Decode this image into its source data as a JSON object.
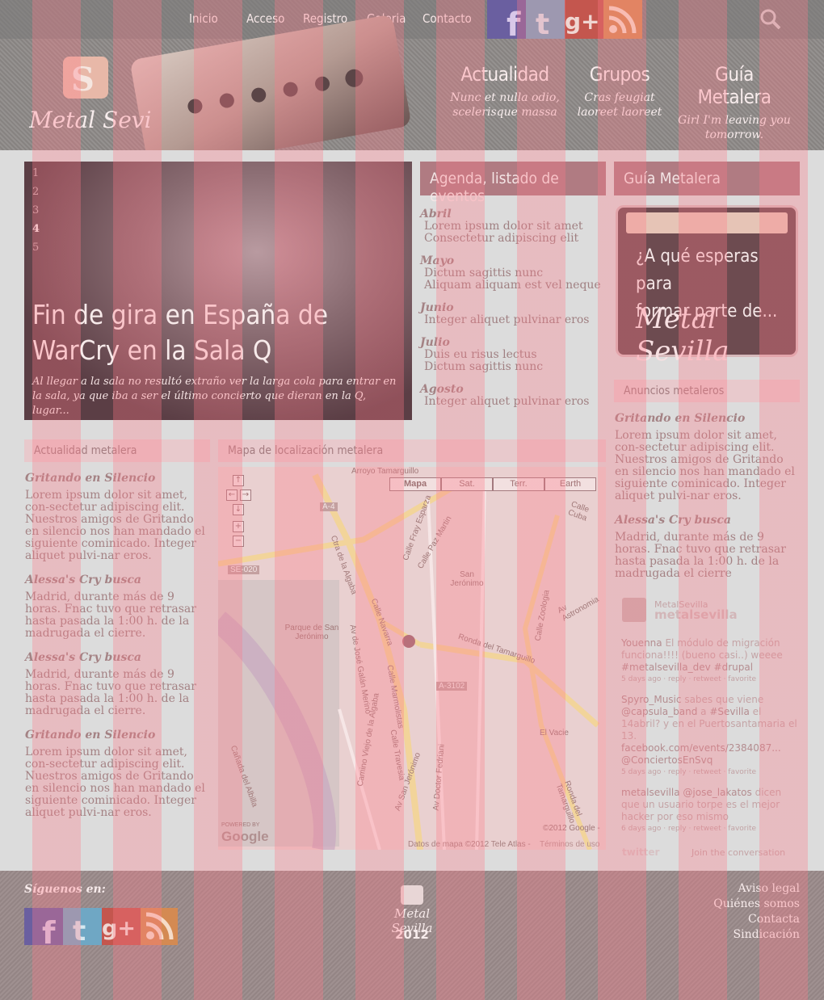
{
  "nav": {
    "items": [
      "Inicio",
      "Acceso",
      "Registro",
      "Galeria",
      "Contacto"
    ]
  },
  "social": [
    "facebook-icon",
    "twitter-icon",
    "googleplus-icon",
    "rss-icon"
  ],
  "brand": {
    "name": "Metal Sevilla"
  },
  "promos": [
    {
      "title": "Actualidad",
      "text": "Nunc et nulla odio, scelerisque massa"
    },
    {
      "title": "Grupos",
      "text": "Cras feugiat laoreet laoreet"
    },
    {
      "title": "Guía Metalera",
      "text": "Girl I'm leaving you tomorrow."
    }
  ],
  "slider": {
    "numbers": [
      "1",
      "2",
      "3",
      "4",
      "5"
    ],
    "active": "4",
    "title": "Fin de gira en España de WarCry en la Sala Q",
    "text": "Al llegar a la sala no resultó extraño ver la larga cola para entrar en la sala, ya que iba a ser el último concierto que dieran en la Q, lugar..."
  },
  "agenda": {
    "title": "Agenda, listado de eventos",
    "months": [
      {
        "name": "Abril",
        "events": [
          "Lorem ipsum dolor sit amet",
          "Consectetur adipiscing elit"
        ]
      },
      {
        "name": "Mayo",
        "events": [
          "Dictum sagittis nunc",
          "Aliquam aliquam est vel neque"
        ]
      },
      {
        "name": "Junio",
        "events": [
          "Integer aliquet pulvinar eros"
        ]
      },
      {
        "name": "Julio",
        "events": [
          "Duis eu risus lectus",
          "Dictum sagittis nunc"
        ]
      },
      {
        "name": "Agosto",
        "events": [
          "Integer aliquet pulvinar eros"
        ]
      }
    ]
  },
  "guia": {
    "title": "Guía Metalera",
    "promo_line1": "¿A qué esperas para",
    "promo_line2": "formar parte de...",
    "promo_logo": "Metal Sevilla"
  },
  "anuncios": {
    "title": "Anuncios metaleros",
    "items": [
      {
        "title": "Gritando en Silencio",
        "text": "Lorem ipsum dolor sit amet, con-sectetur adipiscing elit. Nuestros amigos de Gritando en silencio nos han mandado el siguiente cominicado. Integer aliquet pulvi-nar eros."
      },
      {
        "title": "Alessa's Cry busca",
        "text": "Madrid, durante más de 9 horas. Fnac tuvo que retrasar hasta pasada la 1:00 h. de la madrugada el cierre"
      }
    ]
  },
  "actualidad": {
    "title": "Actualidad metalera",
    "items": [
      {
        "title": "Gritando en Silencio",
        "text": "Lorem ipsum dolor sit amet, con-sectetur adipiscing elit. Nuestros amigos de Gritando en silencio nos han mandado el siguiente cominicado. Integer aliquet pulvi-nar eros."
      },
      {
        "title": "Alessa's Cry busca",
        "text": "Madrid, durante más de 9 horas. Fnac tuvo que retrasar hasta pasada la 1:00 h. de la madrugada el cierre."
      },
      {
        "title": "Alessa's Cry busca",
        "text": "Madrid, durante más de 9 horas. Fnac tuvo que retrasar hasta pasada la 1:00 h. de la madrugada el cierre."
      },
      {
        "title": "Gritando en Silencio",
        "text": "Lorem ipsum dolor sit amet, con-sectetur adipiscing elit. Nuestros amigos de Gritando en silencio nos han mandado el siguiente cominicado. Integer aliquet pulvi-nar eros."
      }
    ]
  },
  "map": {
    "title": "Mapa de localización metalera",
    "tabs": [
      "Mapa",
      "Sat.",
      "Terr.",
      "Earth"
    ],
    "active_tab": "Mapa",
    "labels": [
      "Arroyo Tamarguillo",
      "A-4",
      "SE-020",
      "Parque de San Jerónimo",
      "San Jerónimo",
      "Ronda del Tamarguillo",
      "A-3102",
      "El Vacie",
      "Av Astronomia",
      "Calle Cuba",
      "Ctra de la Algaba",
      "Calle Navarra",
      "Calle Zoologia",
      "Av de José Galán Merino",
      "Calle Marmolistas",
      "Av San Jerónimo",
      "Av Doctor Fedriani",
      "Calle Fray Esparza",
      "Calle Paz Martin",
      "Camino Viejo de la Algaba",
      "Calle Travesia",
      "Ronda del Tamarguillo",
      "Cañada del Albilla"
    ],
    "powered": "POWERED BY",
    "google": "Google",
    "copyright": "©2012 Google -",
    "datos": "Datos de mapa ©2012 Tele Atlas -",
    "terminos": "Términos de uso"
  },
  "twitter": {
    "account_name": "MetalSevilla",
    "handle": "metalsevilla",
    "tweets": [
      {
        "user": "Youenna",
        "text": "El módulo de migración funciona!!!! (bueno casi..) weeee",
        "tag": "#metalsevilla_dev #drupal",
        "meta": "5 days ago · reply · retweet · favorite"
      },
      {
        "user": "Spyro_Music",
        "text": "sabes que viene",
        "mention": "@capsula_band",
        "text2": "a",
        "tag": "#Sevilla",
        "text3": "el 14abril? y en el Puertosantamaria el 13.",
        "link": "facebook.com/events/2384087...",
        "mention2": "@ConciertosEnSvq",
        "meta": "5 days ago · reply · retweet · favorite"
      },
      {
        "user": "metalsevilla",
        "mention": "@jose_lakatos",
        "text": "dicen que un usuario torpe es el mejor hacker por eso mismo",
        "meta": "6 days ago · reply · retweet · favorite"
      }
    ],
    "brand": "twitter",
    "join": "Join the conversation"
  },
  "footer": {
    "follow": "Síguenos en:",
    "year": "2012",
    "logo": "Metal Sevilla",
    "links": [
      "Aviso legal",
      "Quiénes somos",
      "Contacta",
      "Sindicación"
    ]
  },
  "colors": {
    "accent": "#b07b82",
    "overlay": "#ff7887",
    "footer_bg": "#9a8a8a"
  }
}
